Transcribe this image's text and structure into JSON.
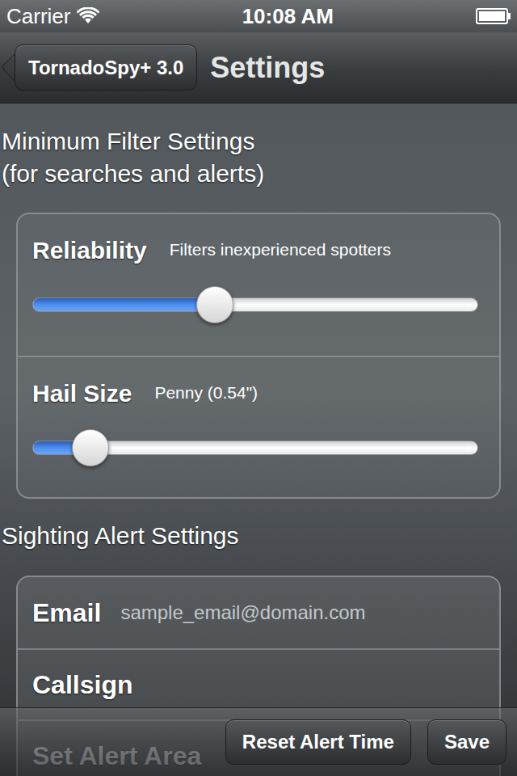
{
  "status_bar": {
    "carrier": "Carrier",
    "time": "10:08 AM",
    "battery_level": 1
  },
  "nav_bar": {
    "back": "TornadoSpy+ 3.0",
    "title": "Settings"
  },
  "filter_section": {
    "title": "Minimum Filter Settings",
    "subtitle": "(for searches and alerts)",
    "sliders": [
      {
        "label": "Reliability",
        "reading": "Filters inexperienced spotters",
        "level": 0.41
      },
      {
        "label": "Hail Size",
        "reading": "Penny (0.54\")",
        "level": 0.13
      }
    ]
  },
  "alert_section": {
    "title": "Sighting Alert Settings",
    "rows": [
      {
        "kind": "field",
        "label": "Email",
        "placeholder": "sample_email@domain.com"
      },
      {
        "kind": "field",
        "label": "Callsign",
        "placeholder": ""
      },
      {
        "kind": "link",
        "label": "Set Alert Area",
        "placeholder": ""
      }
    ]
  },
  "toolbar": {
    "buttons": [
      "Reset Alert Time",
      "Save"
    ]
  }
}
